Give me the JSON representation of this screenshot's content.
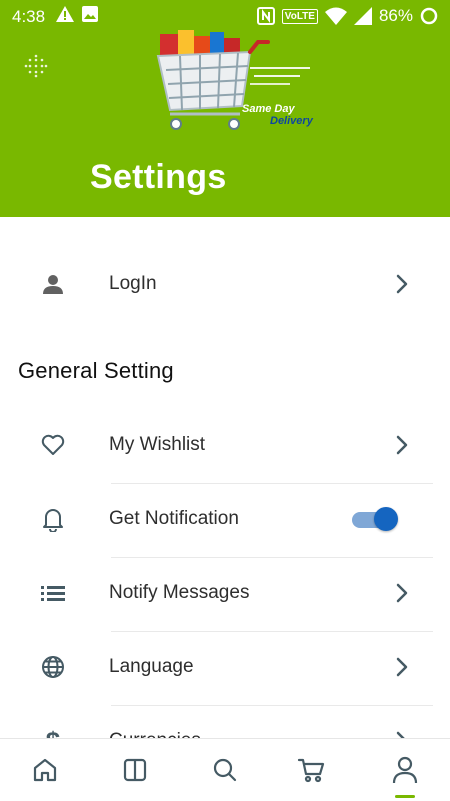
{
  "status_bar": {
    "time": "4:38",
    "volte": "VoLTE",
    "battery": "86%"
  },
  "header": {
    "logo_tagline_1": "Same Day",
    "logo_tagline_2": "Delivery",
    "title": "Settings"
  },
  "login": {
    "label": "LogIn"
  },
  "general": {
    "section_title": "General Setting",
    "items": [
      {
        "label": "My Wishlist",
        "icon": "heart-icon"
      },
      {
        "label": "Get Notification",
        "icon": "bell-icon",
        "toggle": true
      },
      {
        "label": "Notify Messages",
        "icon": "list-icon"
      },
      {
        "label": "Language",
        "icon": "globe-icon"
      },
      {
        "label": "Currencies",
        "icon": "dollar-icon"
      }
    ]
  },
  "bottom_nav": {
    "items": [
      "home-icon",
      "categories-icon",
      "search-icon",
      "cart-icon",
      "profile-icon"
    ],
    "active": "profile-icon"
  },
  "colors": {
    "brand_green": "#79b800",
    "toggle_on": "#1565c0",
    "icon_gray": "#455a64"
  }
}
